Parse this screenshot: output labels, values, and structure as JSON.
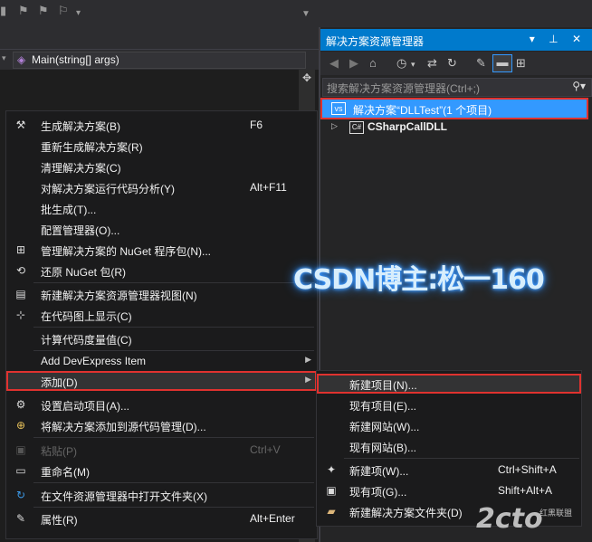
{
  "editor": {
    "nav_combo": "Main(string[] args)"
  },
  "solution_explorer": {
    "title": "解决方案资源管理器",
    "title_controls": "▾ ⊥ ✕",
    "search_placeholder": "搜索解决方案资源管理器(Ctrl+;)",
    "solution_label": "解决方案“DLLTest”(1 个项目)",
    "project_label": "CSharpCallDLL",
    "project_icon_text": "C#"
  },
  "context_menu": {
    "items": [
      {
        "label": "生成解决方案(B)",
        "shortcut": "F6"
      },
      {
        "label": "重新生成解决方案(R)",
        "shortcut": ""
      },
      {
        "label": "清理解决方案(C)",
        "shortcut": ""
      },
      {
        "label": "对解决方案运行代码分析(Y)",
        "shortcut": "Alt+F11"
      },
      {
        "label": "批生成(T)...",
        "shortcut": ""
      },
      {
        "label": "配置管理器(O)...",
        "shortcut": ""
      },
      {
        "label": "管理解决方案的 NuGet 程序包(N)...",
        "shortcut": ""
      },
      {
        "label": "还原 NuGet 包(R)",
        "shortcut": ""
      },
      {
        "label": "新建解决方案资源管理器视图(N)",
        "shortcut": ""
      },
      {
        "label": "在代码图上显示(C)",
        "shortcut": ""
      },
      {
        "label": "计算代码度量值(C)",
        "shortcut": ""
      },
      {
        "label": "Add DevExpress Item",
        "shortcut": ""
      },
      {
        "label": "添加(D)",
        "shortcut": ""
      },
      {
        "label": "设置启动项目(A)...",
        "shortcut": ""
      },
      {
        "label": "将解决方案添加到源代码管理(D)...",
        "shortcut": ""
      },
      {
        "label": "粘贴(P)",
        "shortcut": "Ctrl+V"
      },
      {
        "label": "重命名(M)",
        "shortcut": ""
      },
      {
        "label": "在文件资源管理器中打开文件夹(X)",
        "shortcut": ""
      },
      {
        "label": "属性(R)",
        "shortcut": "Alt+Enter"
      }
    ]
  },
  "submenu": {
    "items": [
      {
        "label": "新建项目(N)...",
        "shortcut": ""
      },
      {
        "label": "现有项目(E)...",
        "shortcut": ""
      },
      {
        "label": "新建网站(W)...",
        "shortcut": ""
      },
      {
        "label": "现有网站(B)...",
        "shortcut": ""
      },
      {
        "label": "新建项(W)...",
        "shortcut": "Ctrl+Shift+A"
      },
      {
        "label": "现有项(G)...",
        "shortcut": "Shift+Alt+A"
      },
      {
        "label": "新建解决方案文件夹(D)",
        "shortcut": ""
      }
    ]
  },
  "watermark": "CSDN博主:松一160",
  "logo": "2cto",
  "logo_sub": "红黑联盟",
  "colors": {
    "accent": "#007acc",
    "selection": "#3399ff",
    "highlight_border": "#e0322f"
  }
}
